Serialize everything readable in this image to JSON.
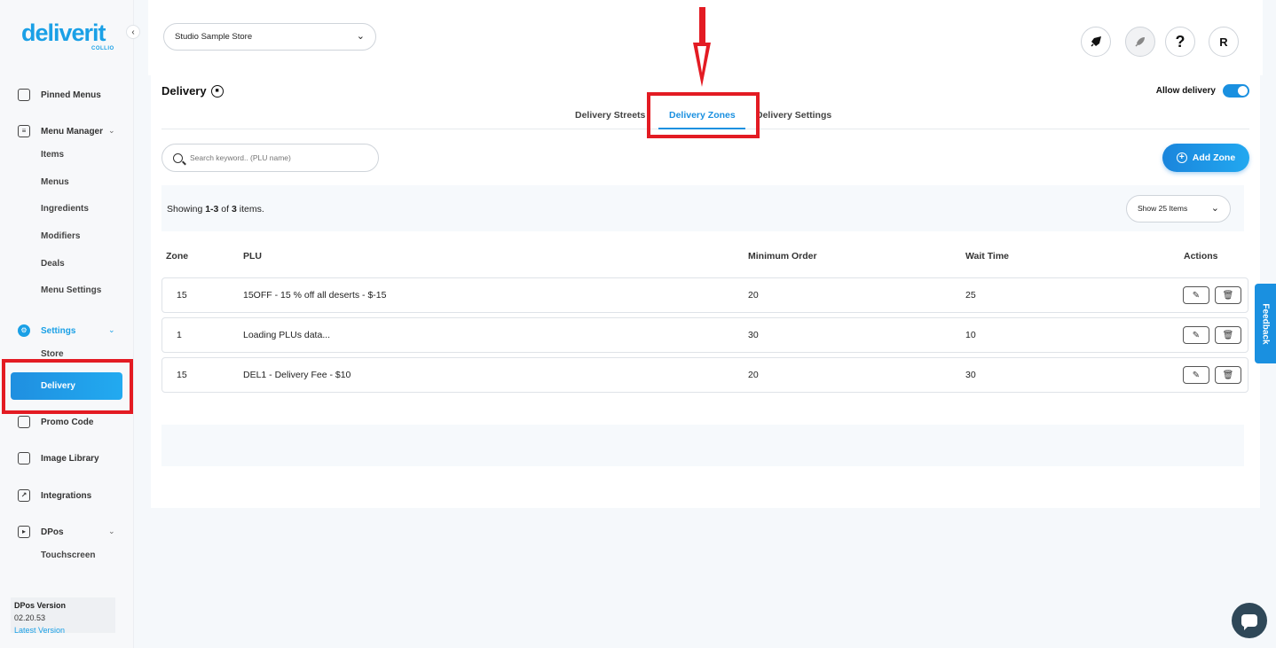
{
  "brand": {
    "name": "deliverit",
    "sub": "COLLIO"
  },
  "sidebar": {
    "pinned": "Pinned Menus",
    "menu_manager": "Menu Manager",
    "menu_items": [
      "Items",
      "Menus",
      "Ingredients",
      "Modifiers",
      "Deals",
      "Menu Settings"
    ],
    "settings": "Settings",
    "settings_items": [
      "Store",
      "Delivery"
    ],
    "promo": "Promo Code",
    "image_library": "Image Library",
    "integrations": "Integrations",
    "dpos": "DPos",
    "dpos_items": [
      "Touchscreen"
    ],
    "version_title": "DPos Version",
    "version_number": "02.20.53",
    "version_link": "Latest Version"
  },
  "header": {
    "store": "Studio Sample Store",
    "avatar": "R",
    "help": "?"
  },
  "page": {
    "title": "Delivery",
    "allow_label": "Allow delivery",
    "allow_enabled": true,
    "tabs": [
      "Delivery Streets",
      "Delivery Zones",
      "Delivery Settings"
    ],
    "active_tab": "Delivery Zones",
    "search_placeholder": "Search keyword.. (PLU name)",
    "add_button": "Add Zone",
    "showing_prefix": "Showing ",
    "showing_range": "1-3",
    "showing_mid": " of ",
    "showing_total": "3",
    "showing_suffix": " items.",
    "per_page": "Show 25 Items"
  },
  "table": {
    "headers": [
      "Zone",
      "PLU",
      "Minimum Order",
      "Wait Time",
      "Actions"
    ],
    "rows": [
      {
        "zone": "15",
        "plu": "15OFF - 15 % off all deserts - $-15",
        "min_order": "20",
        "wait": "25"
      },
      {
        "zone": "1",
        "plu": "Loading PLUs data...",
        "min_order": "30",
        "wait": "10"
      },
      {
        "zone": "15",
        "plu": "DEL1 - Delivery Fee - $10",
        "min_order": "20",
        "wait": "30"
      }
    ]
  },
  "feedback": "Feedback",
  "colors": {
    "accent": "#1a90e0",
    "highlight": "#e31b23"
  }
}
